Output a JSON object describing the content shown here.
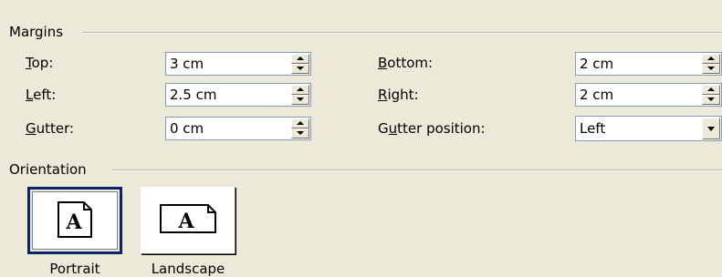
{
  "margins": {
    "group_title": "Margins",
    "top": {
      "label_ul": "T",
      "label_rest": "op:",
      "value": "3 cm"
    },
    "left": {
      "label_ul": "L",
      "label_rest": "eft:",
      "value": "2.5 cm"
    },
    "gutter": {
      "label_ul": "G",
      "label_rest": "utter:",
      "value": "0 cm"
    },
    "bottom": {
      "label_ul": "B",
      "label_rest": "ottom:",
      "value": "2 cm"
    },
    "right": {
      "label_ul": "R",
      "label_rest": "ight:",
      "value": "2 cm"
    },
    "gutter_position": {
      "label_pre": "G",
      "label_ul": "u",
      "label_rest": "tter position:",
      "value": "Left"
    }
  },
  "orientation": {
    "group_title": "Orientation",
    "portrait": {
      "label": "Portrait",
      "glyph": "A",
      "selected": true
    },
    "landscape": {
      "label": "Landscape",
      "glyph": "A",
      "selected": false
    }
  }
}
